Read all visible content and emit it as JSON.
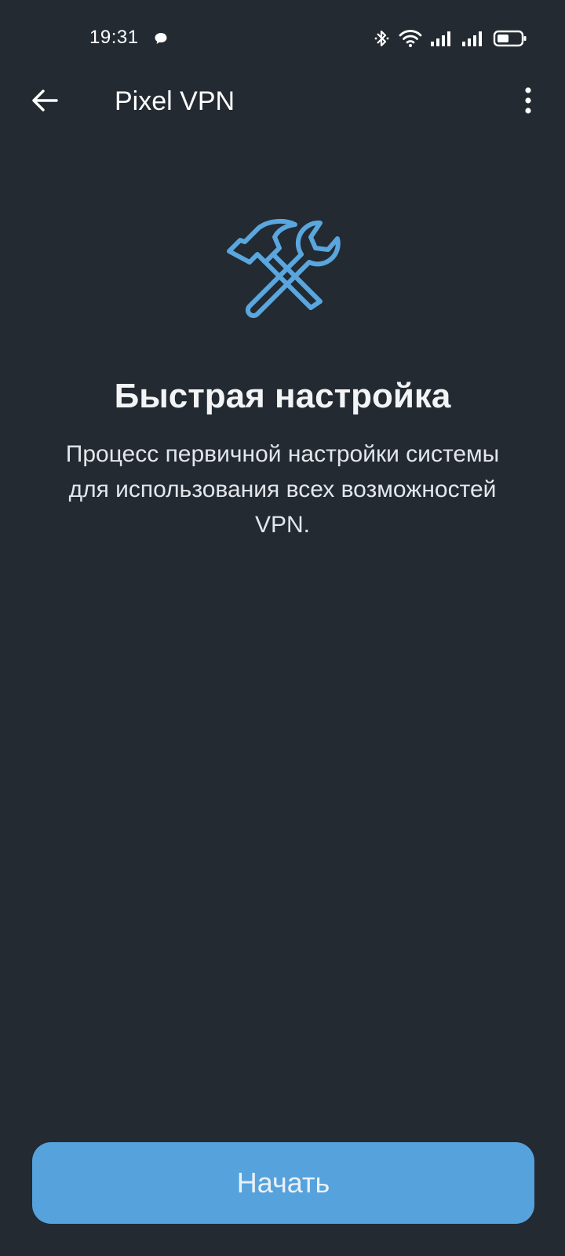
{
  "status_bar": {
    "time": "19:31",
    "icons": [
      "chat-bubble-icon",
      "bluetooth-icon",
      "wifi-icon",
      "signal-icon",
      "signal-icon",
      "battery-icon"
    ]
  },
  "app_bar": {
    "title": "Pixel VPN",
    "back_icon": "arrow-left-icon",
    "menu_icon": "more-vert-icon"
  },
  "hero": {
    "icon": "hammer-wrench-icon",
    "title": "Быстрая настройка",
    "description": "Процесс первичной настройки системы для использования всех возможностей VPN."
  },
  "start_button": {
    "label": "Начать"
  },
  "colors": {
    "background": "#232a31",
    "accent": "#56a2dc",
    "icon_accent": "#5aa6de",
    "text": "#ffffff"
  }
}
